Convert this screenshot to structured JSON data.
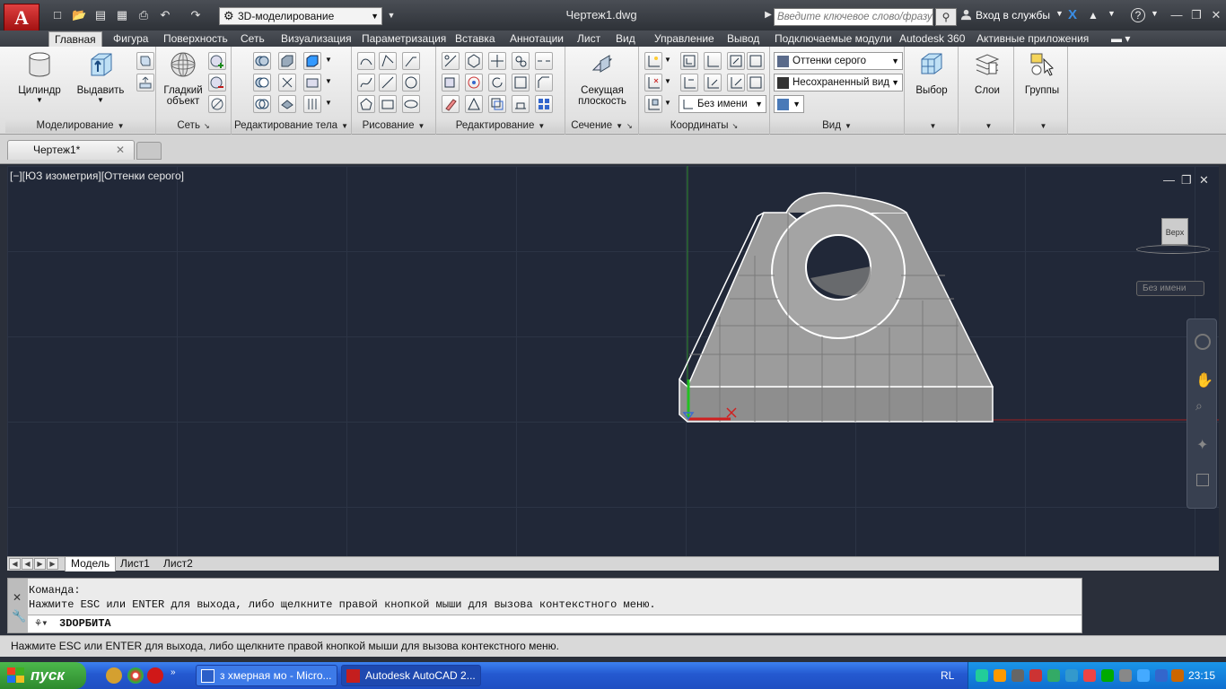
{
  "title": {
    "logo_letter": "A",
    "workspace": "3D-моделирование",
    "document": "Чертеж1.dwg",
    "search_placeholder": "Введите ключевое слово/фразу",
    "signin": "Вход в службы",
    "help": "?"
  },
  "ribbon_tabs": [
    {
      "label": "Главная",
      "active": true
    },
    {
      "label": "Фигура"
    },
    {
      "label": "Поверхность"
    },
    {
      "label": "Сеть"
    },
    {
      "label": "Визуализация"
    },
    {
      "label": "Параметризация"
    },
    {
      "label": "Вставка"
    },
    {
      "label": "Аннотации"
    },
    {
      "label": "Лист"
    },
    {
      "label": "Вид"
    },
    {
      "label": "Управление"
    },
    {
      "label": "Вывод"
    },
    {
      "label": "Подключаемые модули"
    },
    {
      "label": "Autodesk 360"
    },
    {
      "label": "Активные приложения"
    }
  ],
  "ribbon": {
    "modeling": {
      "title": "Моделирование",
      "cylinder": "Цилиндр",
      "extrude": "Выдавить"
    },
    "mesh": {
      "title": "Сеть",
      "smooth_1": "Гладкий",
      "smooth_2": "объект"
    },
    "solid_edit": {
      "title": "Редактирование тела"
    },
    "draw": {
      "title": "Рисование"
    },
    "modify": {
      "title": "Редактирование"
    },
    "section": {
      "title": "Сечение",
      "plane_1": "Секущая",
      "plane_2": "плоскость"
    },
    "coordinates": {
      "title": "Координаты",
      "ucs_name": "Без имени"
    },
    "view": {
      "title": "Вид",
      "visual_style": "Оттенки серого",
      "named_view": "Несохраненный вид"
    },
    "selection": {
      "label": "Выбор"
    },
    "layers": {
      "label": "Слои"
    },
    "groups": {
      "label": "Группы"
    }
  },
  "file_tab": {
    "label": "Чертеж1*"
  },
  "viewport": {
    "label": "[−][ЮЗ изометрия][Оттенки серого]",
    "viewcube_face": "Верх",
    "ucs_menu": "Без имени"
  },
  "layout_tabs": [
    "Модель",
    "Лист1",
    "Лист2"
  ],
  "command": {
    "line1": "Команда:",
    "line2": "Нажмите ESC или ENTER для выхода, либо щелкните правой кнопкой мыши для вызова контекстного меню.",
    "input": "3DОРБИТА"
  },
  "status_text": "Нажмите ESC или ENTER для выхода, либо щелкните правой кнопкой мыши для вызова контекстного меню.",
  "taskbar": {
    "start": "пуск",
    "tasks": [
      {
        "label": "з хмерная мо - Micro..."
      },
      {
        "label": "Autodesk AutoCAD 2..."
      }
    ],
    "lang": "RL",
    "clock": "23:15"
  },
  "colors": {
    "accent": "#c41e1e",
    "viewport_bg": "#212838",
    "model_fill": "#9a9a9a"
  }
}
